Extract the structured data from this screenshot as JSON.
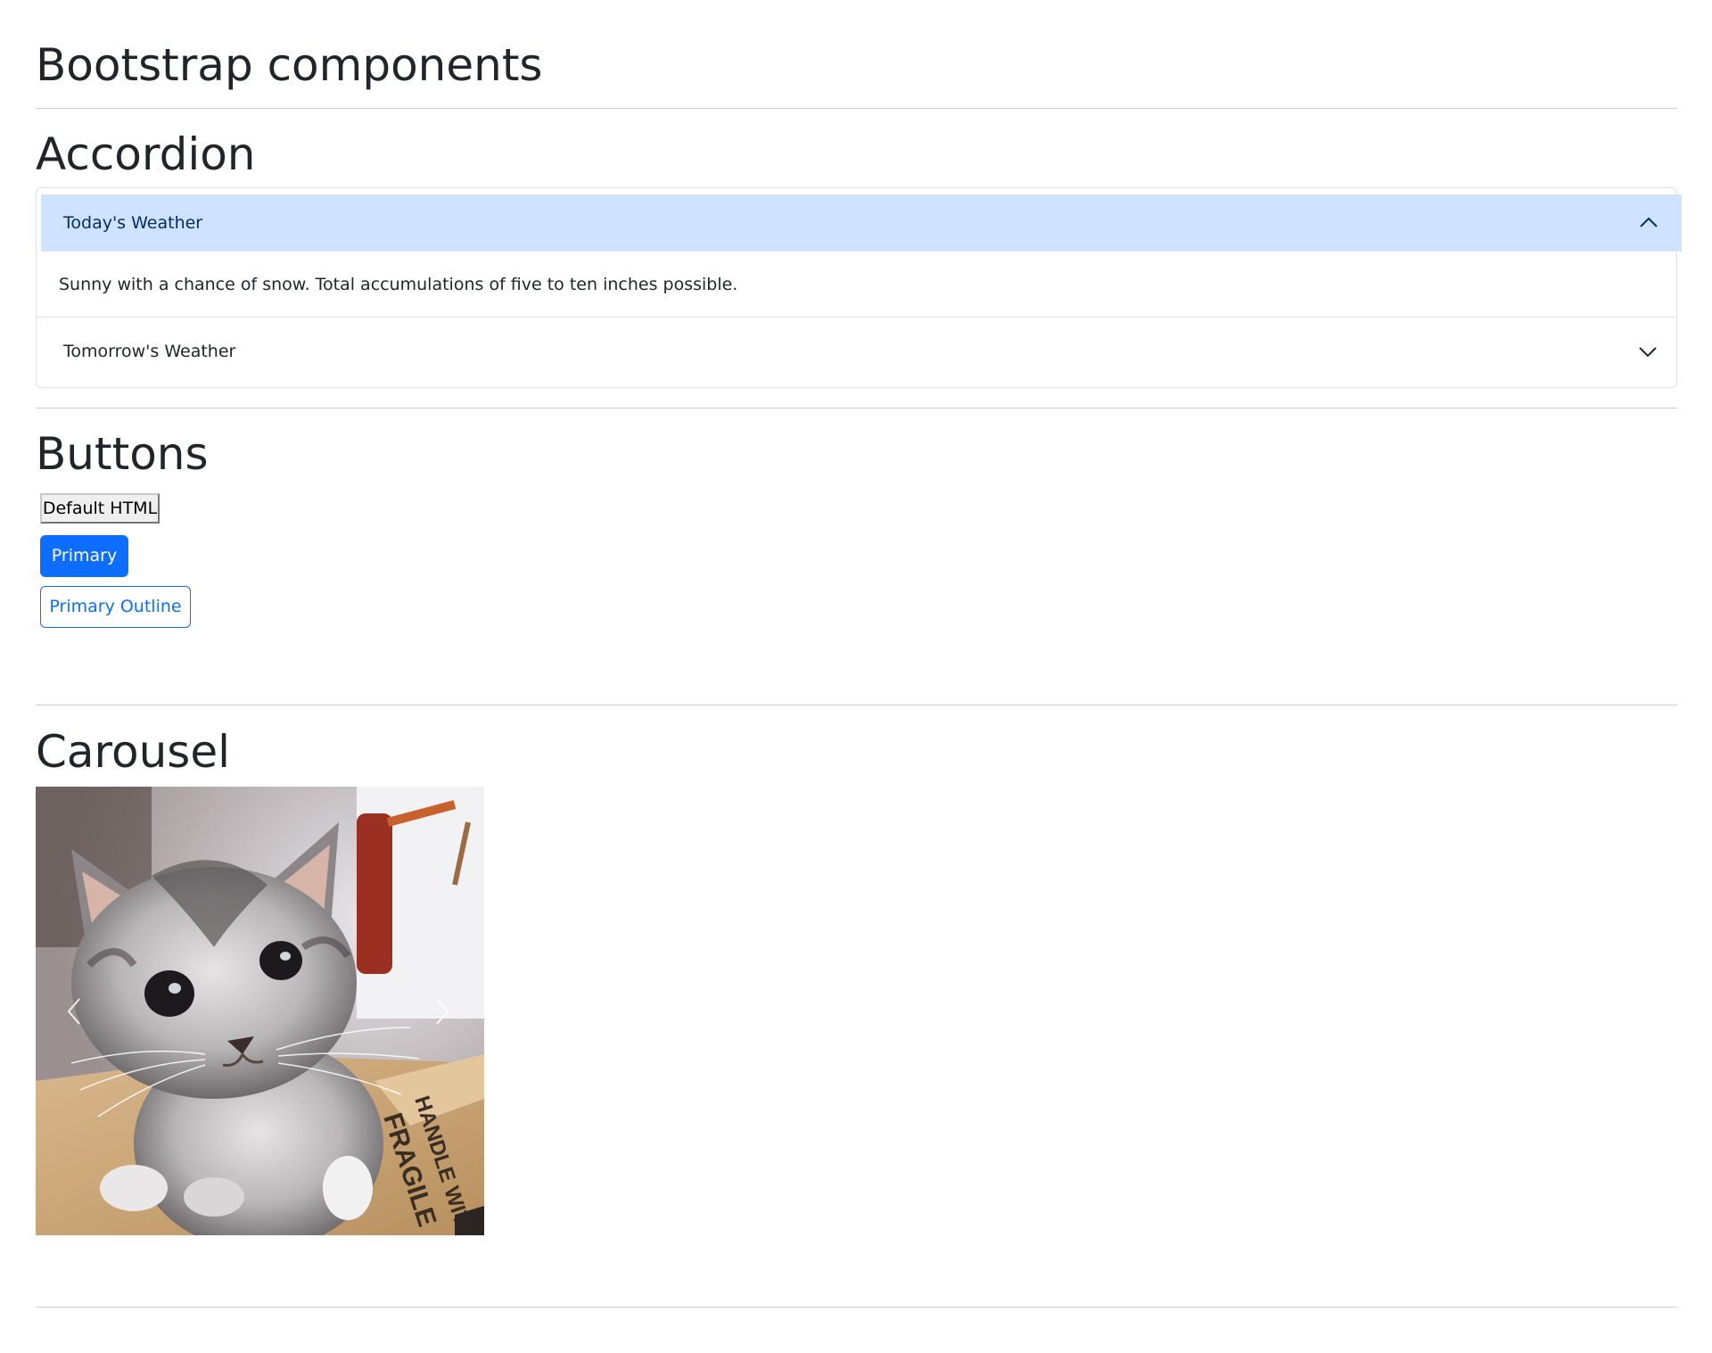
{
  "page": {
    "title": "Bootstrap components"
  },
  "accordion": {
    "heading": "Accordion",
    "items": [
      {
        "label": "Today's Weather",
        "expanded": true,
        "body": "Sunny with a chance of snow. Total accumulations of five to ten inches possible."
      },
      {
        "label": "Tomorrow's Weather",
        "expanded": false
      }
    ],
    "colors": {
      "active_header_bg": "#cfe2ff",
      "active_header_text": "#052c65",
      "border": "#dee2e6"
    }
  },
  "buttons": {
    "heading": "Buttons",
    "default_label": "Default HTML",
    "primary_label": "Primary",
    "outline_label": "Primary Outline",
    "colors": {
      "primary": "#0d6efd"
    }
  },
  "carousel": {
    "heading": "Carousel",
    "prev_icon": "chevron-left-icon",
    "next_icon": "chevron-right-icon",
    "image_subject": "kitten-photo",
    "box_text": [
      "FRAGILE",
      "HANDLE WITH CARE"
    ]
  }
}
